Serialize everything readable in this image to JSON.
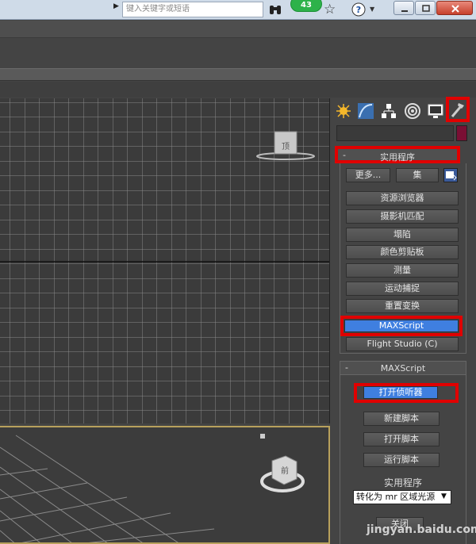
{
  "browser": {
    "search_placeholder": "键入关键字或短语",
    "badge_count": "43"
  },
  "viewport_top": {
    "viewcube_label": "顶"
  },
  "viewport_persp": {
    "viewcube_label": "前"
  },
  "panel": {
    "tabs": [
      "create-tab",
      "modify-tab",
      "hierarchy-tab",
      "motion-tab",
      "display-tab",
      "utilities-tab"
    ],
    "utilities_rollout": {
      "title": "实用程序",
      "more_label": "更多...",
      "sets_label": "集",
      "buttons": [
        "资源浏览器",
        "摄影机匹配",
        "塌陷",
        "颜色剪贴板",
        "测量",
        "运动捕捉",
        "重置变换",
        "MAXScript",
        "Flight Studio (C)"
      ]
    },
    "maxscript_rollout": {
      "title": "MAXScript",
      "open_listener": "打开侦听器",
      "new_script": "新建脚本",
      "open_script": "打开脚本",
      "run_script": "运行脚本",
      "utilities_label": "实用程序",
      "dropdown_value": "转化为 mr 区域光源",
      "close_label": "关闭"
    }
  },
  "watermark": "jingyan.baidu.com"
}
